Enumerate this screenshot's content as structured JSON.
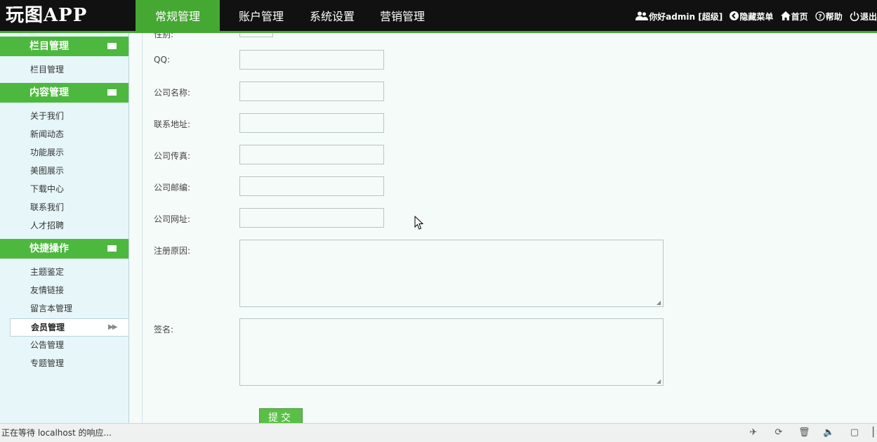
{
  "header": {
    "logo": "玩图APP",
    "tabs": [
      {
        "label": "常规管理",
        "active": true
      },
      {
        "label": "账户管理",
        "active": false
      },
      {
        "label": "系统设置",
        "active": false
      },
      {
        "label": "营销管理",
        "active": false
      }
    ],
    "user_greeting": "你好admin",
    "user_role": "[超级]",
    "hide_menu": "隐藏菜单",
    "home": "首页",
    "help": "帮助",
    "logout": "退出"
  },
  "sidebar": {
    "sections": [
      {
        "title": "栏目管理",
        "items": [
          "栏目管理"
        ]
      },
      {
        "title": "内容管理",
        "items": [
          "关于我们",
          "新闻动态",
          "功能展示",
          "美图展示",
          "下载中心",
          "联系我们",
          "人才招聘"
        ]
      },
      {
        "title": "快捷操作",
        "items": [
          "主题鉴定",
          "友情链接",
          "留言本管理",
          "会员管理",
          "公告管理",
          "专题管理"
        ]
      }
    ],
    "active_item": "会员管理"
  },
  "form": {
    "gender_label": "性别:",
    "fields": [
      {
        "label": "QQ:",
        "value": ""
      },
      {
        "label": "公司名称:",
        "value": ""
      },
      {
        "label": "联系地址:",
        "value": ""
      },
      {
        "label": "公司传真:",
        "value": ""
      },
      {
        "label": "公司邮编:",
        "value": ""
      },
      {
        "label": "公司网址:",
        "value": ""
      }
    ],
    "textareas": [
      {
        "label": "注册原因:",
        "value": ""
      },
      {
        "label": "签名:",
        "value": ""
      }
    ],
    "submit_label": "提交"
  },
  "statusbar": {
    "text": "正在等待 localhost 的响应..."
  },
  "colors": {
    "accent": "#45a832",
    "header_bg": "#111111",
    "sidebar_bg": "#e6f6f9",
    "main_bg": "#f5fbf9"
  }
}
